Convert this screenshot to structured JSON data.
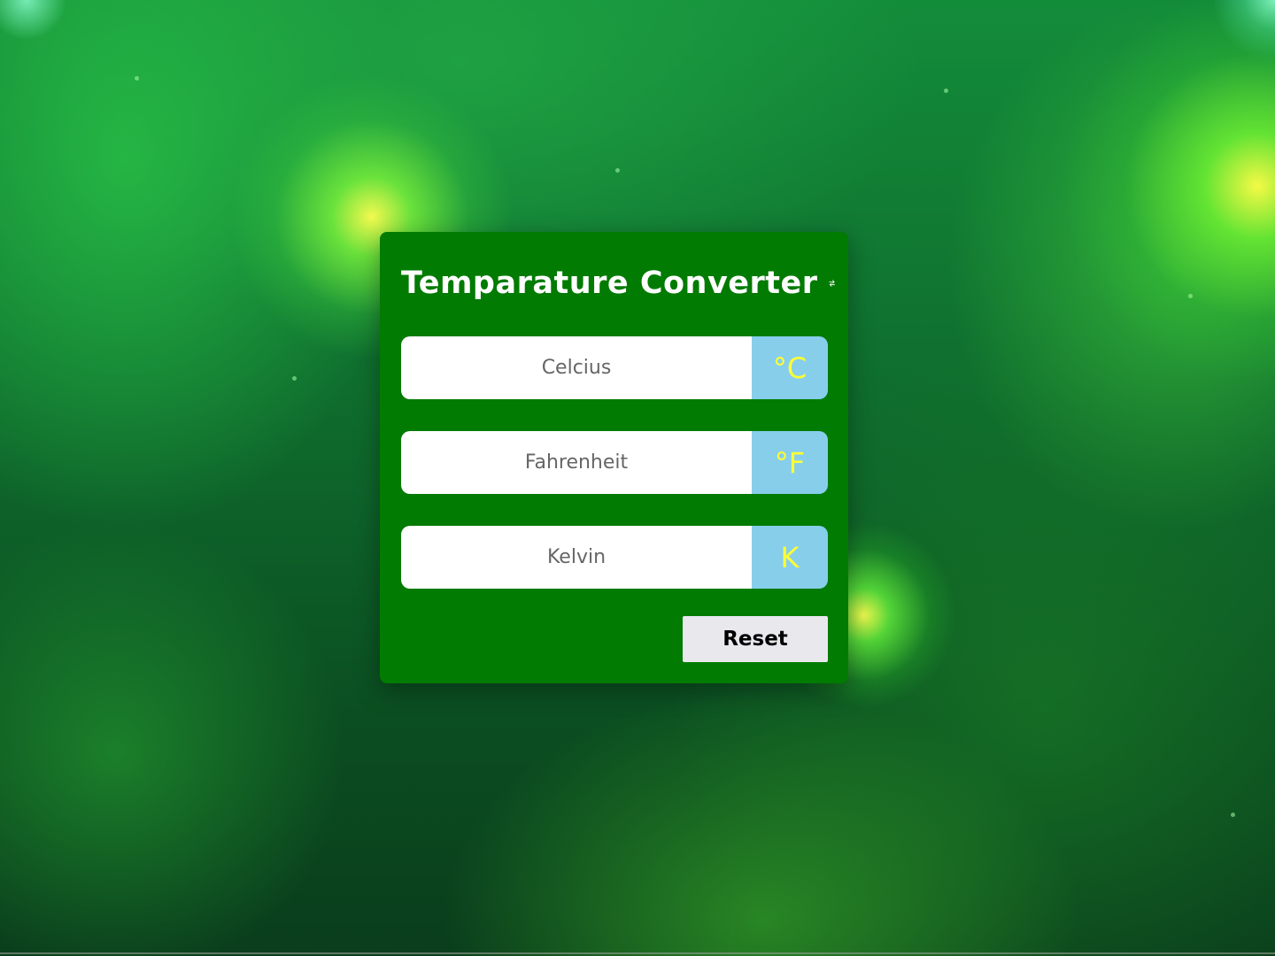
{
  "app": {
    "title": "Temparature Converter",
    "title_icon": "swap-arrows-icon"
  },
  "fields": [
    {
      "placeholder": "Celcius",
      "value": "",
      "unit": "°C"
    },
    {
      "placeholder": "Fahrenheit",
      "value": "",
      "unit": "°F"
    },
    {
      "placeholder": "Kelvin",
      "value": "",
      "unit": "K"
    }
  ],
  "reset_label": "Reset",
  "colors": {
    "card_background": "#017b01",
    "unit_background": "#87ceeb",
    "unit_text": "#ffff33",
    "button_background": "#e9e8ed"
  }
}
